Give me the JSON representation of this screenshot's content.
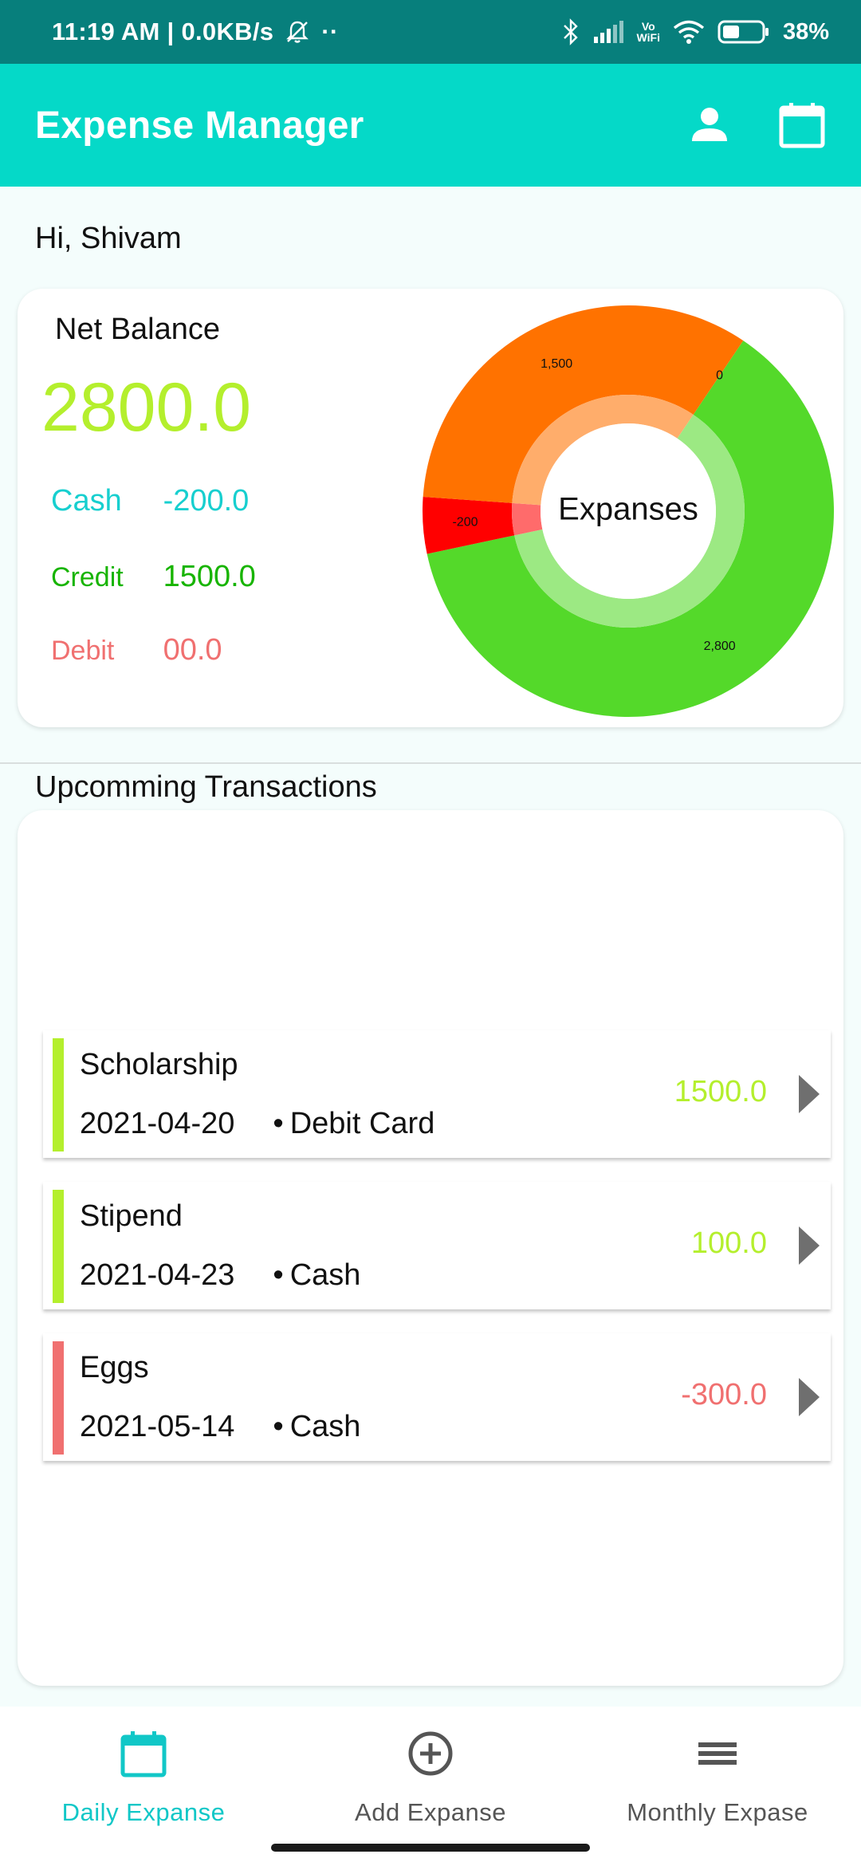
{
  "status_bar": {
    "time_speed": "11:19 AM | 0.0KB/s",
    "dots": "··",
    "vowifi_top": "Vo",
    "vowifi_bottom": "WiFi",
    "battery": "38%"
  },
  "app_bar": {
    "title": "Expense Manager",
    "icons": [
      "person-icon",
      "calendar-icon"
    ]
  },
  "greeting": "Hi, Shivam",
  "balance_card": {
    "title": "Net Balance",
    "net_balance": "2800.0",
    "rows": [
      {
        "label": "Cash",
        "value": "-200.0"
      },
      {
        "label": "Credit",
        "value": "1500.0"
      },
      {
        "label": "Debit",
        "value": "00.0"
      }
    ]
  },
  "chart_data": {
    "type": "pie",
    "center_text": "Expanses",
    "slices": [
      {
        "value": 2800,
        "label": "2,800",
        "color": "#54d92a"
      },
      {
        "value": 200,
        "label": "-200",
        "color": "#ff0000"
      },
      {
        "value": 1500,
        "label": "1,500",
        "color": "#ff7200"
      },
      {
        "value": 0,
        "label": "0",
        "color": "#888888"
      }
    ]
  },
  "upcoming": {
    "title": "Upcomming Transactions",
    "items": [
      {
        "name": "Scholarship",
        "date": "2021-04-20",
        "method": "Debit Card",
        "amount": "1500.0",
        "color": "#b4ef2d"
      },
      {
        "name": "Stipend",
        "date": "2021-04-23",
        "method": "Cash",
        "amount": "100.0",
        "color": "#b4ef2d"
      },
      {
        "name": "Eggs",
        "date": "2021-05-14",
        "method": "Cash",
        "amount": "-300.0",
        "color": "#f07070"
      }
    ]
  },
  "bottom_nav": {
    "items": [
      {
        "label": "Daily Expanse",
        "icon": "calendar-icon",
        "active": true
      },
      {
        "label": "Add Expanse",
        "icon": "add-circle-icon",
        "active": false
      },
      {
        "label": "Monthly Expase",
        "icon": "list-icon",
        "active": false
      }
    ],
    "active_color": "#11c7c7"
  }
}
